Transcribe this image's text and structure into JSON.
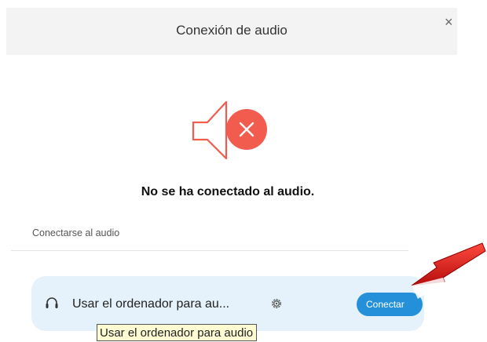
{
  "dialog": {
    "title": "Conexión de audio",
    "close_glyph": "×",
    "status_text": "No se ha conectado al audio.",
    "section_label": "Conectarse al audio",
    "illustration_icon": "speaker-muted-icon"
  },
  "audio_option": {
    "icon": "headset-icon",
    "label": "Usar el ordenador para au...",
    "settings_icon": "gear-icon",
    "connect_button": "Conectar",
    "tooltip": "Usar el ordenador para audio"
  },
  "colors": {
    "header_bg": "#f3f3f3",
    "mute_red": "#f25c4f",
    "row_bg": "#e6f2fb",
    "button_blue": "#2590da",
    "annotation_arrow": "#e11b1b"
  }
}
